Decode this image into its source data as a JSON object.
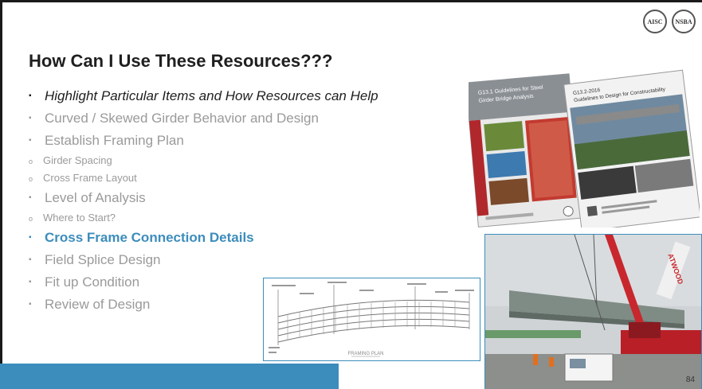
{
  "slide": {
    "title": "How Can I Use These Resources???",
    "bullets": [
      {
        "text": "Highlight Particular Items and How Resources can Help",
        "level": 1,
        "style": "dark"
      },
      {
        "text": "Curved / Skewed Girder Behavior and Design",
        "level": 1,
        "style": "muted"
      },
      {
        "text": "Establish Framing Plan",
        "level": 1,
        "style": "muted"
      },
      {
        "text": "Girder Spacing",
        "level": 2,
        "style": "muted"
      },
      {
        "text": "Cross Frame Layout",
        "level": 2,
        "style": "muted"
      },
      {
        "text": "Level of Analysis",
        "level": 1,
        "style": "muted"
      },
      {
        "text": "Where to Start?",
        "level": 2,
        "style": "muted"
      },
      {
        "text": "Cross Frame Connection Details",
        "level": 1,
        "style": "active"
      },
      {
        "text": "Field Splice Design",
        "level": 1,
        "style": "muted"
      },
      {
        "text": "Fit up Condition",
        "level": 1,
        "style": "muted"
      },
      {
        "text": "Review of Design",
        "level": 1,
        "style": "muted"
      }
    ],
    "page_number": "84"
  },
  "logos": [
    "AISC",
    "NSBA"
  ],
  "framing_plan": {
    "caption": "FRAMING PLAN"
  },
  "covers": {
    "left_title": "G13.1 Guidelines for Steel Girder Bridge Analysis",
    "right_title": "G13.1-2016 Guidelines to Design for Constructability"
  },
  "photo": {
    "crane_label": "ATWOOD"
  },
  "colors": {
    "accent": "#3c8dbc",
    "title": "#1f1f1f",
    "muted": "#9a9a9a"
  }
}
